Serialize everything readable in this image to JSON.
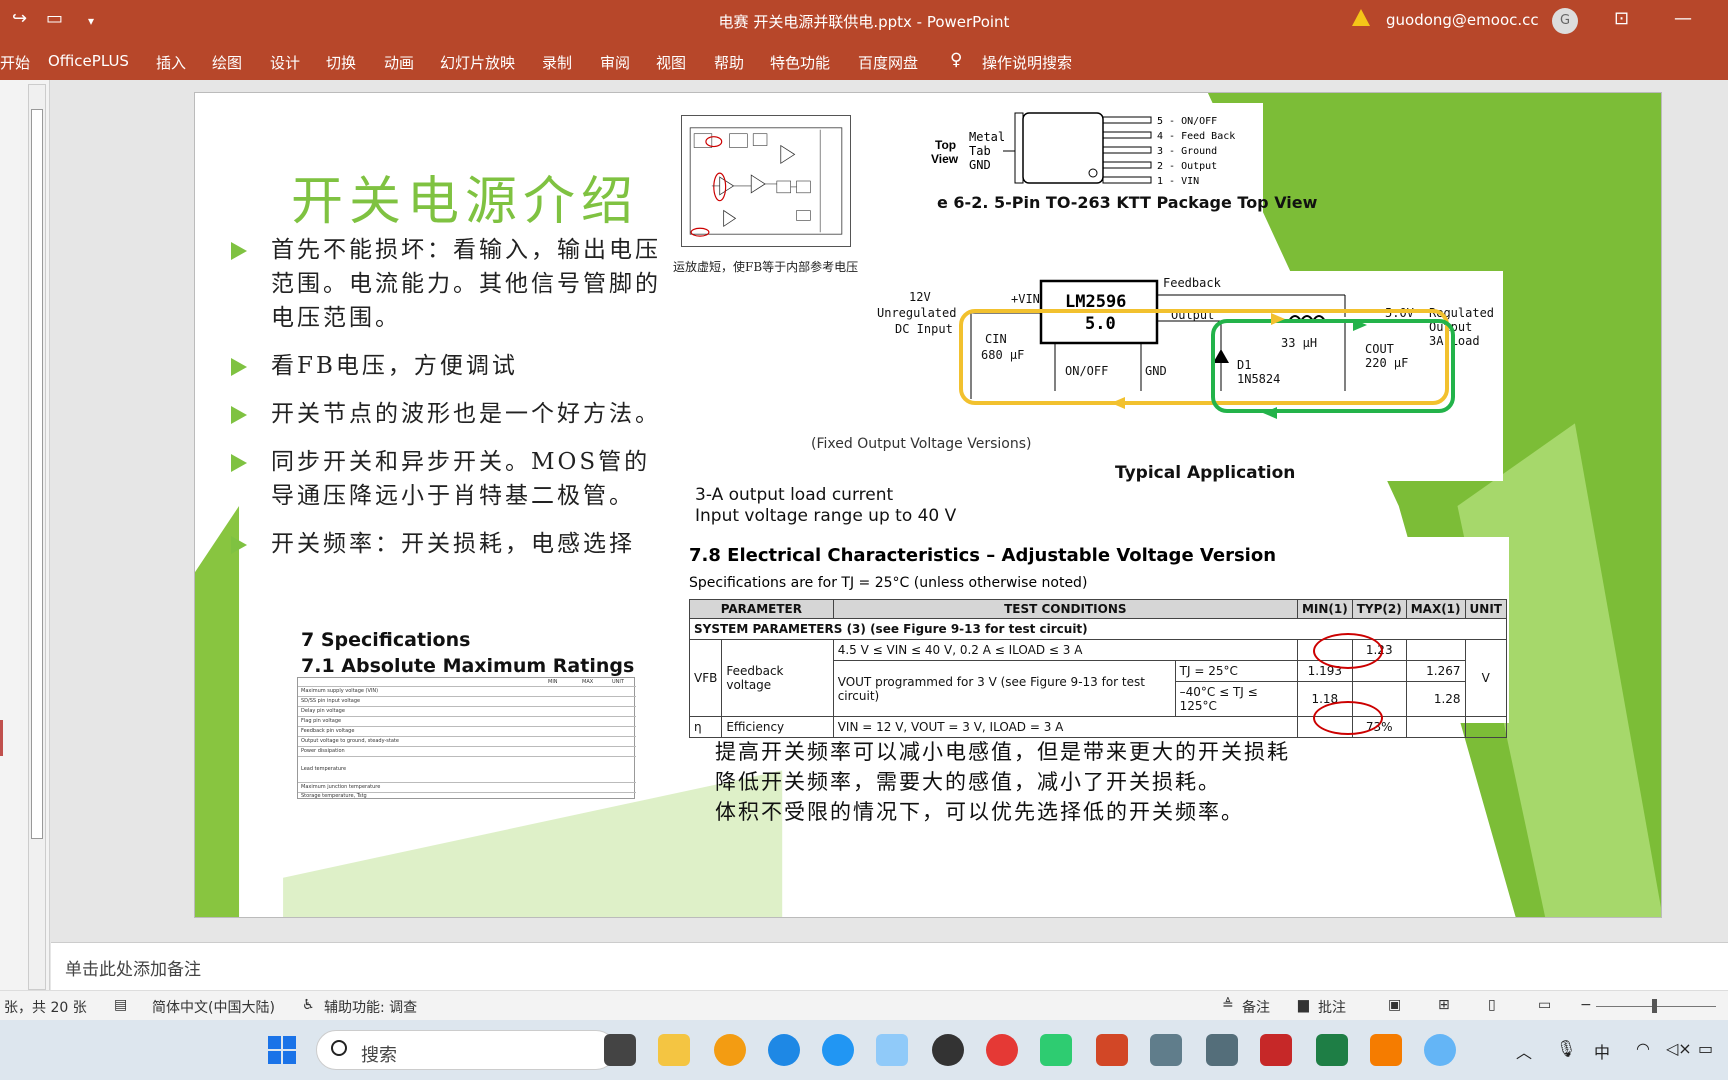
{
  "app": {
    "title": "电赛 开关电源并联供电.pptx - PowerPoint",
    "user": "guodong@emooc.cc",
    "avatar_letter": "G"
  },
  "ribbon": {
    "tabs": [
      "开始",
      "OfficePLUS",
      "插入",
      "绘图",
      "设计",
      "切换",
      "动画",
      "幻灯片放映",
      "录制",
      "审阅",
      "视图",
      "帮助",
      "特色功能",
      "百度网盘",
      "操作说明搜索"
    ]
  },
  "slide": {
    "heading": "开关电源介绍",
    "bullets": [
      "首先不能损坏：看输入，输出电压范围。电流能力。其他信号管脚的电压范围。",
      "看FB电压，方便调试",
      "开关节点的波形也是一个好方法。",
      "同步开关和异步开关。MOS管的导通压降远小于肖特基二极管。",
      "开关频率：开关损耗，电感选择"
    ],
    "circuit_caption": "运放虚短，使FB等于内部参考电压",
    "package": {
      "view": "Top View",
      "tab": "Metal Tab GND",
      "pins": [
        "5 - ON/OFF",
        "4 - Feed Back",
        "3 - Ground",
        "2 - Output",
        "1 - VIN"
      ],
      "caption": "e 6-2. 5-Pin TO-263 KTT Package Top View"
    },
    "app_circuit": {
      "chip": "LM2596",
      "chip_sub": "5.0",
      "input": "12V Unregulated DC Input",
      "vin": "+VIN",
      "feedback": "Feedback",
      "output": "Output",
      "inductor": "L1 33 µH",
      "vout": "5.0V",
      "regulated": "Regulated Output 3A Load",
      "cin": "CIN 680 µF",
      "onoff": "ON/OFF",
      "gnd": "GND",
      "diode": "D1 1N5824",
      "cout": "COUT 220 µF",
      "fixed_caption": "(Fixed Output Voltage Versions)",
      "typ_caption": "Typical Application"
    },
    "spec_lines": [
      "3-A output load current",
      "Input voltage range up to 40 V"
    ],
    "ec": {
      "title": "7.8 Electrical Characteristics – Adjustable Voltage Version",
      "subtitle": "Specifications are for TJ = 25°C (unless otherwise noted)",
      "headers": [
        "PARAMETER",
        "TEST CONDITIONS",
        "MIN(1)",
        "TYP(2)",
        "MAX(1)",
        "UNIT"
      ],
      "system_row": "SYSTEM PARAMETERS (3) (see Figure 9-13 for test circuit)",
      "rows": [
        {
          "sym": "VFB",
          "name": "Feedback voltage",
          "cond": "4.5 V ≤ VIN ≤ 40 V, 0.2 A ≤ ILOAD ≤ 3 A",
          "min": "",
          "typ": "1.23",
          "max": "",
          "unit": "V"
        },
        {
          "sym": "",
          "name": "",
          "cond": "VOUT programmed for 3 V (see Figure 9-13 for test circuit)",
          "sub": "TJ = 25°C",
          "min": "1.193",
          "typ": "",
          "max": "1.267",
          "unit": ""
        },
        {
          "sym": "",
          "name": "",
          "cond": "",
          "sub": "–40°C ≤ TJ ≤ 125°C",
          "min": "1.18",
          "typ": "",
          "max": "1.28",
          "unit": ""
        },
        {
          "sym": "η",
          "name": "Efficiency",
          "cond": "VIN = 12 V, VOUT = 3 V, ILOAD = 3 A",
          "min": "",
          "typ": "73%",
          "max": "",
          "unit": ""
        }
      ]
    },
    "spec7": [
      "7 Specifications",
      "7.1 Absolute Maximum Ratings"
    ],
    "spec7_table_header": [
      "MIN",
      "MAX",
      "UNIT"
    ],
    "spec7_rows": [
      "Maximum supply voltage (VIN)",
      "SD/SS pin input voltage",
      "Delay pin voltage",
      "Flag pin voltage",
      "Feedback pin voltage",
      "Output voltage to ground, steady-state",
      "Power dissipation",
      "Lead temperature",
      "Maximum junction temperature",
      "Storage temperature, Tstg"
    ],
    "bottom_note": [
      "提高开关频率可以减小电感值，但是带来更大的开关损耗",
      "降低开关频率，需要大的感值，减小了开关损耗。",
      "体积不受限的情况下，可以优先选择低的开关频率。"
    ]
  },
  "notes_placeholder": "单击此处添加备注",
  "status": {
    "slide_count": "张，共 20 张",
    "language": "简体中文(中国大陆)",
    "accessibility": "辅助功能: 调查",
    "notes": "备注",
    "comments": "批注"
  },
  "taskbar": {
    "search": "搜索",
    "ime": "中"
  }
}
